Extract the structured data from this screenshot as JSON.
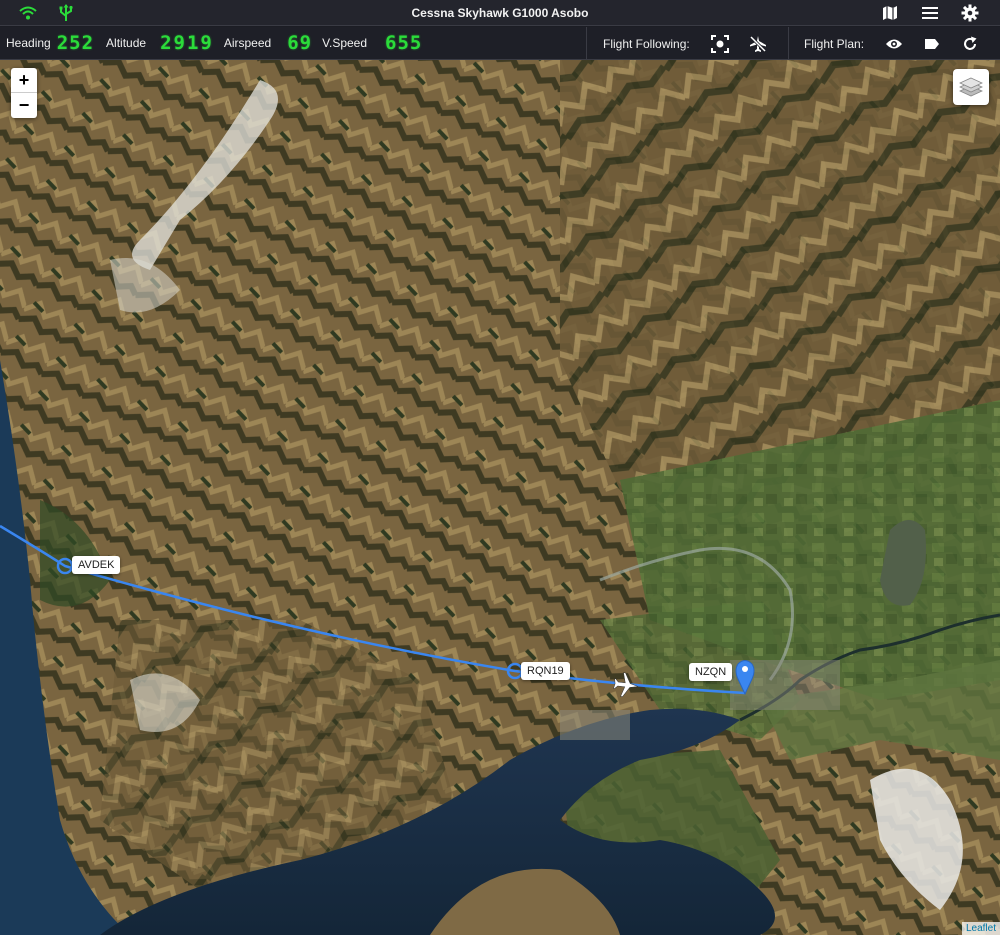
{
  "app": {
    "title": "Cessna Skyhawk G1000 Asobo"
  },
  "titlebar_icons": [
    "wifi-icon",
    "usb-icon",
    "map-icon",
    "menu-icon",
    "gear-icon"
  ],
  "instruments": {
    "heading": {
      "label": "Heading",
      "value": "252"
    },
    "altitude": {
      "label": "Altitude",
      "value": "2919"
    },
    "airspeed": {
      "label": "Airspeed",
      "value": "69"
    },
    "vspeed": {
      "label": "V.Speed",
      "value": "655"
    }
  },
  "flight_following": {
    "label": "Flight Following:"
  },
  "flight_plan": {
    "label": "Flight Plan:"
  },
  "map": {
    "zoom_in": "+",
    "zoom_out": "−",
    "waypoints": [
      {
        "name": "AVDEK"
      },
      {
        "name": "RQN19"
      },
      {
        "name": "NZQN"
      }
    ],
    "attribution": "Leaflet"
  },
  "colors": {
    "digit_green": "#2bdc3a",
    "route_blue": "#3a86f0",
    "bar_bg": "#1e1f27"
  }
}
